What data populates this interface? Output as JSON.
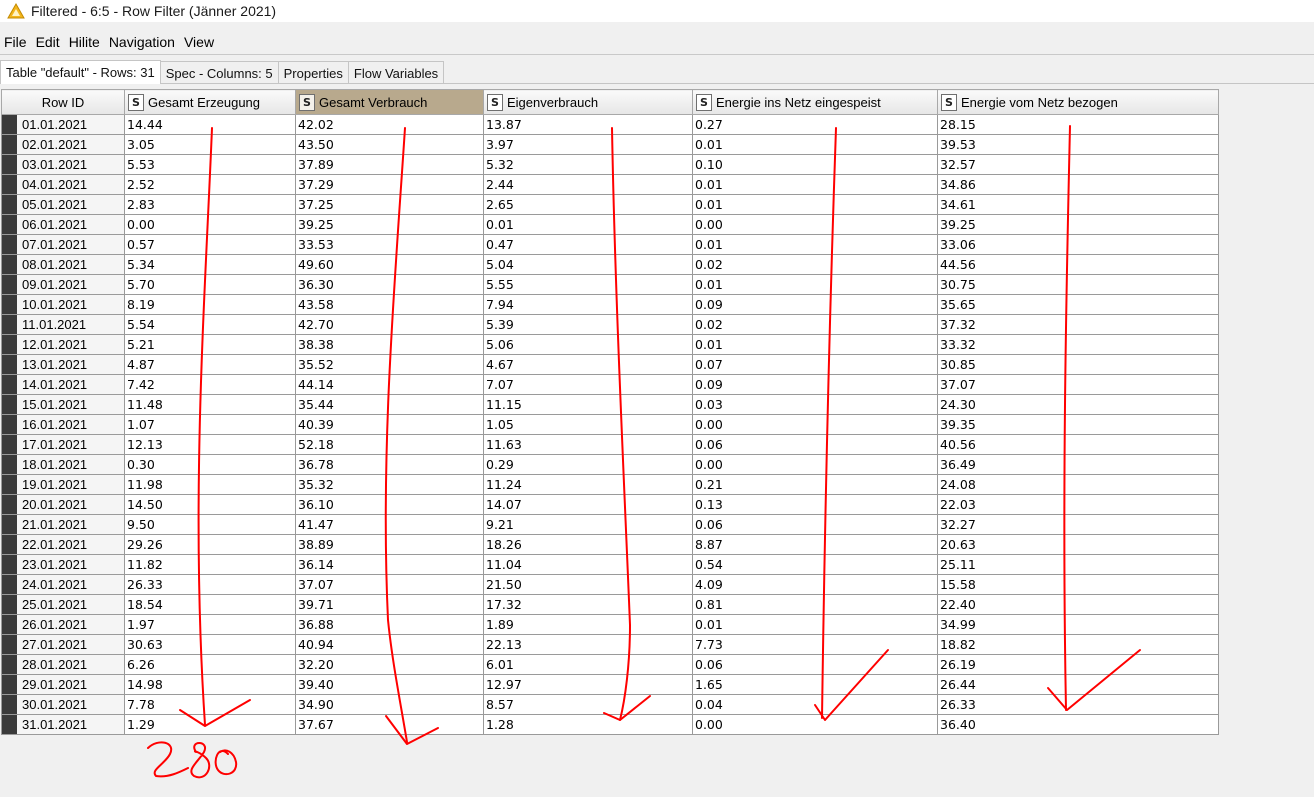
{
  "window": {
    "title": "Filtered - 6:5 - Row Filter (Jänner 2021)",
    "icon": "warning-triangle-icon"
  },
  "menu": [
    "File",
    "Edit",
    "Hilite",
    "Navigation",
    "View"
  ],
  "tabs": [
    {
      "label": "Table \"default\" - Rows: 31",
      "active": true
    },
    {
      "label": "Spec - Columns: 5",
      "active": false
    },
    {
      "label": "Properties",
      "active": false
    },
    {
      "label": "Flow Variables",
      "active": false
    }
  ],
  "table": {
    "rowid_header": "Row ID",
    "type_badge": "S",
    "columns": [
      "Gesamt Erzeugung",
      "Gesamt Verbrauch",
      "Eigenverbrauch",
      "Energie ins Netz eingespeist",
      "Energie vom Netz bezogen"
    ],
    "selected_column": 1,
    "rows": [
      {
        "id": "01.01.2021",
        "cells": [
          "14.44",
          "42.02",
          "13.87",
          "0.27",
          "28.15"
        ]
      },
      {
        "id": "02.01.2021",
        "cells": [
          "3.05",
          "43.50",
          "3.97",
          "0.01",
          "39.53"
        ]
      },
      {
        "id": "03.01.2021",
        "cells": [
          "5.53",
          "37.89",
          "5.32",
          "0.10",
          "32.57"
        ]
      },
      {
        "id": "04.01.2021",
        "cells": [
          "2.52",
          "37.29",
          "2.44",
          "0.01",
          "34.86"
        ]
      },
      {
        "id": "05.01.2021",
        "cells": [
          "2.83",
          "37.25",
          "2.65",
          "0.01",
          "34.61"
        ]
      },
      {
        "id": "06.01.2021",
        "cells": [
          "0.00",
          "39.25",
          "0.01",
          "0.00",
          "39.25"
        ]
      },
      {
        "id": "07.01.2021",
        "cells": [
          "0.57",
          "33.53",
          "0.47",
          "0.01",
          "33.06"
        ]
      },
      {
        "id": "08.01.2021",
        "cells": [
          "5.34",
          "49.60",
          "5.04",
          "0.02",
          "44.56"
        ]
      },
      {
        "id": "09.01.2021",
        "cells": [
          "5.70",
          "36.30",
          "5.55",
          "0.01",
          "30.75"
        ]
      },
      {
        "id": "10.01.2021",
        "cells": [
          "8.19",
          "43.58",
          "7.94",
          "0.09",
          "35.65"
        ]
      },
      {
        "id": "11.01.2021",
        "cells": [
          "5.54",
          "42.70",
          "5.39",
          "0.02",
          "37.32"
        ]
      },
      {
        "id": "12.01.2021",
        "cells": [
          "5.21",
          "38.38",
          "5.06",
          "0.01",
          "33.32"
        ]
      },
      {
        "id": "13.01.2021",
        "cells": [
          "4.87",
          "35.52",
          "4.67",
          "0.07",
          "30.85"
        ]
      },
      {
        "id": "14.01.2021",
        "cells": [
          "7.42",
          "44.14",
          "7.07",
          "0.09",
          "37.07"
        ]
      },
      {
        "id": "15.01.2021",
        "cells": [
          "11.48",
          "35.44",
          "11.15",
          "0.03",
          "24.30"
        ]
      },
      {
        "id": "16.01.2021",
        "cells": [
          "1.07",
          "40.39",
          "1.05",
          "0.00",
          "39.35"
        ]
      },
      {
        "id": "17.01.2021",
        "cells": [
          "12.13",
          "52.18",
          "11.63",
          "0.06",
          "40.56"
        ]
      },
      {
        "id": "18.01.2021",
        "cells": [
          "0.30",
          "36.78",
          "0.29",
          "0.00",
          "36.49"
        ]
      },
      {
        "id": "19.01.2021",
        "cells": [
          "11.98",
          "35.32",
          "11.24",
          "0.21",
          "24.08"
        ]
      },
      {
        "id": "20.01.2021",
        "cells": [
          "14.50",
          "36.10",
          "14.07",
          "0.13",
          "22.03"
        ]
      },
      {
        "id": "21.01.2021",
        "cells": [
          "9.50",
          "41.47",
          "9.21",
          "0.06",
          "32.27"
        ]
      },
      {
        "id": "22.01.2021",
        "cells": [
          "29.26",
          "38.89",
          "18.26",
          "8.87",
          "20.63"
        ]
      },
      {
        "id": "23.01.2021",
        "cells": [
          "11.82",
          "36.14",
          "11.04",
          "0.54",
          "25.11"
        ]
      },
      {
        "id": "24.01.2021",
        "cells": [
          "26.33",
          "37.07",
          "21.50",
          "4.09",
          "15.58"
        ]
      },
      {
        "id": "25.01.2021",
        "cells": [
          "18.54",
          "39.71",
          "17.32",
          "0.81",
          "22.40"
        ]
      },
      {
        "id": "26.01.2021",
        "cells": [
          "1.97",
          "36.88",
          "1.89",
          "0.01",
          "34.99"
        ]
      },
      {
        "id": "27.01.2021",
        "cells": [
          "30.63",
          "40.94",
          "22.13",
          "7.73",
          "18.82"
        ]
      },
      {
        "id": "28.01.2021",
        "cells": [
          "6.26",
          "32.20",
          "6.01",
          "0.06",
          "26.19"
        ]
      },
      {
        "id": "29.01.2021",
        "cells": [
          "14.98",
          "39.40",
          "12.97",
          "1.65",
          "26.44"
        ]
      },
      {
        "id": "30.01.2021",
        "cells": [
          "7.78",
          "34.90",
          "8.57",
          "0.04",
          "26.33"
        ]
      },
      {
        "id": "31.01.2021",
        "cells": [
          "1.29",
          "37.67",
          "1.28",
          "0.00",
          "36.40"
        ]
      }
    ]
  },
  "annotation": {
    "handwritten_total": "280",
    "ink_color": "#ff0000"
  }
}
